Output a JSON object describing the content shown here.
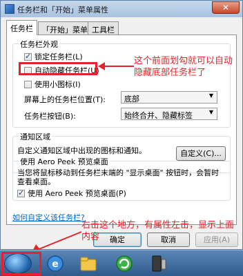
{
  "window": {
    "title": "任务栏和「开始」菜单属性",
    "close_glyph": "✕"
  },
  "tabs": [
    {
      "label": "任务栏"
    },
    {
      "label": "「开始」菜单"
    },
    {
      "label": "工具栏"
    }
  ],
  "appearance": {
    "group_title": "任务栏外观",
    "lock_taskbar": {
      "label": "锁定任务栏(L)",
      "checked": true
    },
    "auto_hide": {
      "label": "自动隐藏任务栏(U)",
      "checked": false
    },
    "small_icons": {
      "label": "使用小图标(I)",
      "checked": false
    },
    "position_label": "屏幕上的任务栏位置(T):",
    "position_value": "底部",
    "buttons_label": "任务栏按钮(B):",
    "buttons_value": "始终合并、隐藏标签"
  },
  "notify": {
    "group_title": "通知区域",
    "description": "自定义通知区域中出现的图标和通知。",
    "customize_button": "自定义(C)..."
  },
  "peek": {
    "group_title": "使用 Aero Peek 预览桌面",
    "description_line1": "当您将鼠标移动到任务栏末端的 \"显示桌面\" 按钮时，会暂时",
    "description_line2": "查看桌面。",
    "checkbox": {
      "label": "使用 Aero Peek 预览桌面(P)",
      "checked": true
    }
  },
  "help_link": "如何自定义该任务栏?",
  "dialog_buttons": {
    "ok": "确定",
    "cancel": "取消",
    "apply": "应用(A)"
  },
  "annotations": {
    "note1_line1": "这个前面划勾就可以自动",
    "note1_line2": "隐藏底部任务栏了",
    "note2_line1": "右击这个地方，有属性左击，显示上面",
    "note2_line2": "内容",
    "color": "#e8202a"
  }
}
